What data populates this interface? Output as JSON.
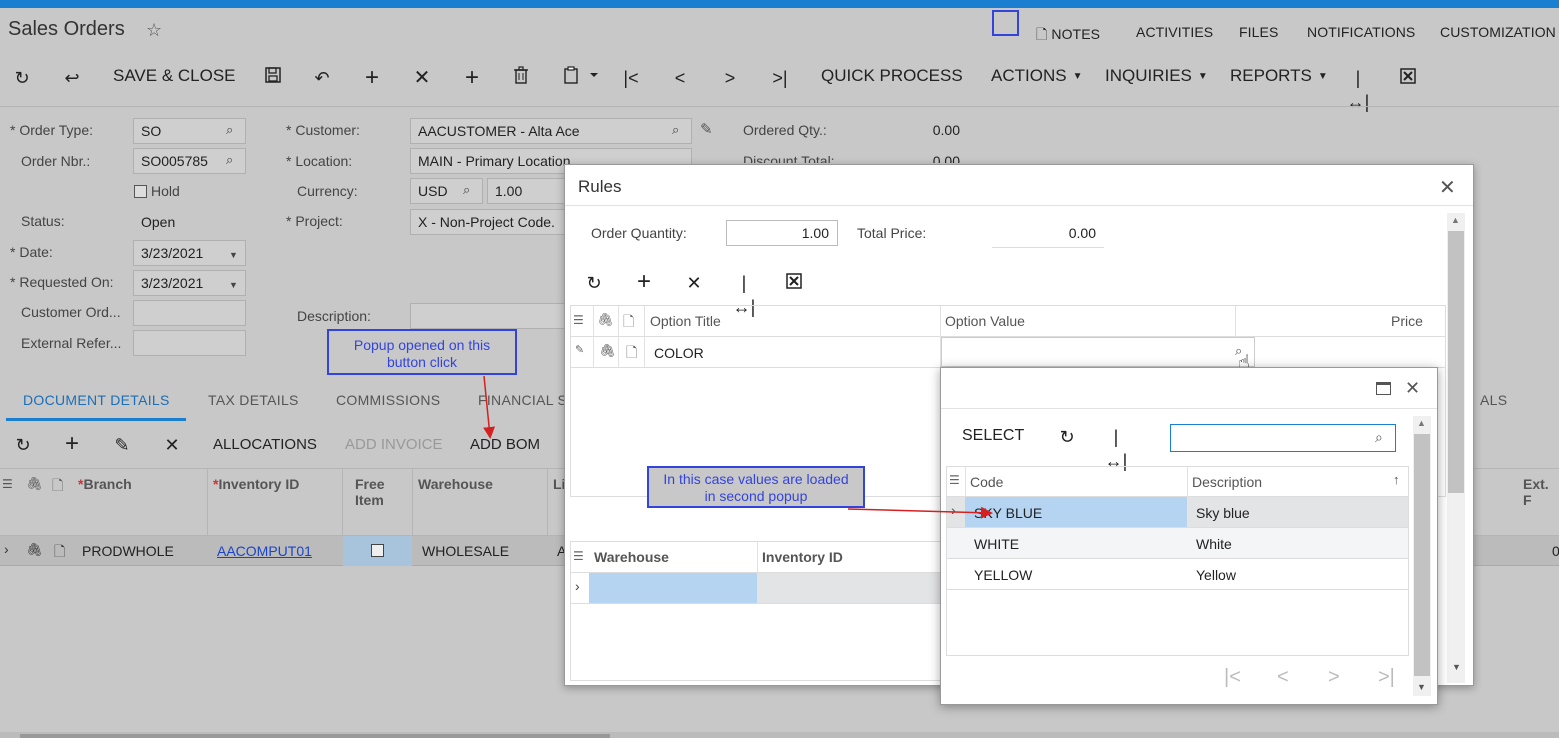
{
  "header": {
    "title": "Sales Orders",
    "links": [
      "NOTES",
      "ACTIVITIES",
      "FILES",
      "NOTIFICATIONS",
      "CUSTOMIZATION"
    ]
  },
  "toolbar": {
    "save_close": "SAVE & CLOSE",
    "quick_process": "QUICK PROCESS",
    "actions": "ACTIONS",
    "inquiries": "INQUIRIES",
    "reports": "REPORTS"
  },
  "form": {
    "order_type_label": "Order Type:",
    "order_type": "SO",
    "order_nbr_label": "Order Nbr.:",
    "order_nbr": "SO005785",
    "hold_label": "Hold",
    "status_label": "Status:",
    "status": "Open",
    "date_label": "Date:",
    "date": "3/23/2021",
    "requested_on_label": "Requested On:",
    "requested_on": "3/23/2021",
    "customer_ord_label": "Customer Ord...",
    "external_ref_label": "External Refer...",
    "customer_label": "Customer:",
    "customer": "AACUSTOMER - Alta Ace",
    "location_label": "Location:",
    "location": "MAIN - Primary Location",
    "currency_label": "Currency:",
    "currency": "USD",
    "currency_rate": "1.00",
    "project_label": "Project:",
    "project": "X - Non-Project Code.",
    "description_label": "Description:",
    "ordered_qty_label": "Ordered Qty.:",
    "ordered_qty": "0.00",
    "discount_total_label": "Discount Total:",
    "discount_total": "0.00"
  },
  "tabs": [
    "DOCUMENT DETAILS",
    "TAX DETAILS",
    "COMMISSIONS",
    "FINANCIAL S",
    "ALS"
  ],
  "grid_toolbar": {
    "allocations": "ALLOCATIONS",
    "add_invoice": "ADD INVOICE",
    "add_bom": "ADD BOM"
  },
  "grid": {
    "headers": {
      "branch": "Branch",
      "inventory_id": "Inventory ID",
      "free_item_1": "Free",
      "free_item_2": "Item",
      "warehouse": "Warehouse",
      "li": "Li",
      "ext": "Ext. F"
    },
    "row": {
      "branch": "PRODWHOLE",
      "inventory_id": "AACOMPUT01",
      "warehouse": "WHOLESALE",
      "li": "A",
      "ext": "0"
    }
  },
  "callouts": {
    "popup_opened_1": "Popup opened on this",
    "popup_opened_2": "button click",
    "second_popup_1": "In this case values are loaded",
    "second_popup_2": "in second popup"
  },
  "rules_dialog": {
    "title": "Rules",
    "order_qty_label": "Order Quantity:",
    "order_qty": "1.00",
    "total_price_label": "Total Price:",
    "total_price": "0.00",
    "headers": {
      "option_title": "Option Title",
      "option_value": "Option Value",
      "price": "Price"
    },
    "row": {
      "option_title": "COLOR"
    },
    "lower_headers": {
      "warehouse": "Warehouse",
      "inventory_id": "Inventory ID"
    }
  },
  "selector_popup": {
    "select": "SELECT",
    "search_value": "",
    "headers": {
      "code": "Code",
      "description": "Description"
    },
    "rows": [
      {
        "code": "SKY BLUE",
        "description": "Sky blue"
      },
      {
        "code": "WHITE",
        "description": "White"
      },
      {
        "code": "YELLOW",
        "description": "Yellow"
      }
    ]
  }
}
